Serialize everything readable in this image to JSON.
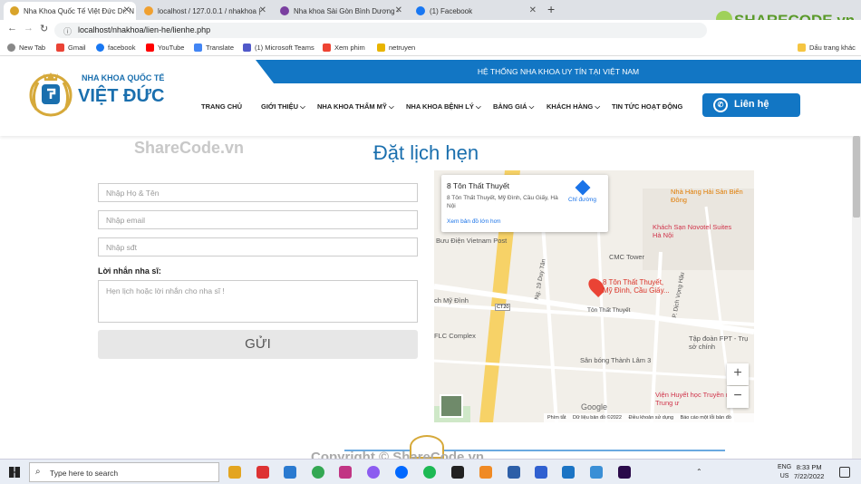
{
  "browser": {
    "tabs": [
      {
        "label": "Nha Khoa Quốc Tế Việt Đức Dr. N",
        "active": true
      },
      {
        "label": "localhost / 127.0.0.1 / nhakhoa |",
        "active": false
      },
      {
        "label": "Nha khoa Sài Gòn Bình Dương -",
        "active": false
      },
      {
        "label": "(1) Facebook",
        "active": false
      }
    ],
    "new_tab": "+",
    "url": "localhost/nhakhoa/lien-he/lienhe.php",
    "bookmarks": [
      "New Tab",
      "Gmail",
      "facebook",
      "YouTube",
      "Translate",
      "(1) Microsoft Teams",
      "Xem phim",
      "netruyen"
    ],
    "bookmarks_right": "Dấu trang khác"
  },
  "watermark": {
    "logo_text": "SHARECODE.vn",
    "overlay": "ShareCode.vn",
    "copyright": "Copyright © ShareCode.vn"
  },
  "header": {
    "banner": "HỆ THỐNG NHA KHOA UY TÍN TẠI VIỆT NAM",
    "logo_top": "NHA KHOA QUỐC TẾ",
    "logo_main": "VIỆT ĐỨC",
    "nav": [
      "TRANG CHỦ",
      "GIỚI THIỆU",
      "NHA KHOA THẨM MỸ",
      "NHA KHOA BỆNH LÝ",
      "BẢNG GIÁ",
      "KHÁCH HÀNG",
      "TIN TỨC HOẠT ĐỘNG"
    ],
    "contact_button": "Liên hệ"
  },
  "booking": {
    "title": "Đặt lịch hẹn",
    "name_placeholder": "Nhập Họ & Tên",
    "email_placeholder": "Nhập email",
    "phone_placeholder": "Nhập sđt",
    "message_label": "Lời nhắn nha sĩ:",
    "message_placeholder": "Hẹn lịch hoặc lời nhắn cho nha sĩ !",
    "submit": "GỬI"
  },
  "map": {
    "place_name": "8 Tôn Thất Thuyết",
    "place_address": "8 Tôn Thất Thuyết, Mỹ Đình, Cầu Giấy, Hà Nội",
    "directions": "Chỉ đường",
    "larger_map": "Xem bản đồ lớn hơn",
    "pin_label": "8 Tôn Thất Thuyết, Mỹ Đình, Cầu Giấy...",
    "labels": {
      "post": "Bưu Điện Vietnam Post",
      "restaurant": "Nhà Hàng Hải Sản Biển Đông",
      "hotel": "Khách Sạn Novotel Suites Hà Nội",
      "cmc": "CMC Tower",
      "street1": "Tôn Thất Thuyết",
      "street2": "Ng. 19 Duy Tân",
      "street3": "P. Dịch Vọng Hậu",
      "fpt": "Tập đoàn FPT - Trụ sở chính",
      "flc": "FLC Complex",
      "my_dinh": "ch Mỹ Đình",
      "stadium": "Sân bóng Thành Lâm 3",
      "hospital": "Viện Huyết học Truyền máu Trung ư",
      "road": "CT20"
    },
    "footer": [
      "Phím tắt",
      "Dữ liệu bản đồ ©2022",
      "Điều khoản sử dụng",
      "Báo cáo một lỗi bản đồ"
    ],
    "google": "Google",
    "zoom_in": "+",
    "zoom_out": "−"
  },
  "taskbar": {
    "search_placeholder": "Type here to search",
    "lang": "ENG",
    "region": "US",
    "time": "8:33 PM",
    "date": "7/22/2022"
  }
}
